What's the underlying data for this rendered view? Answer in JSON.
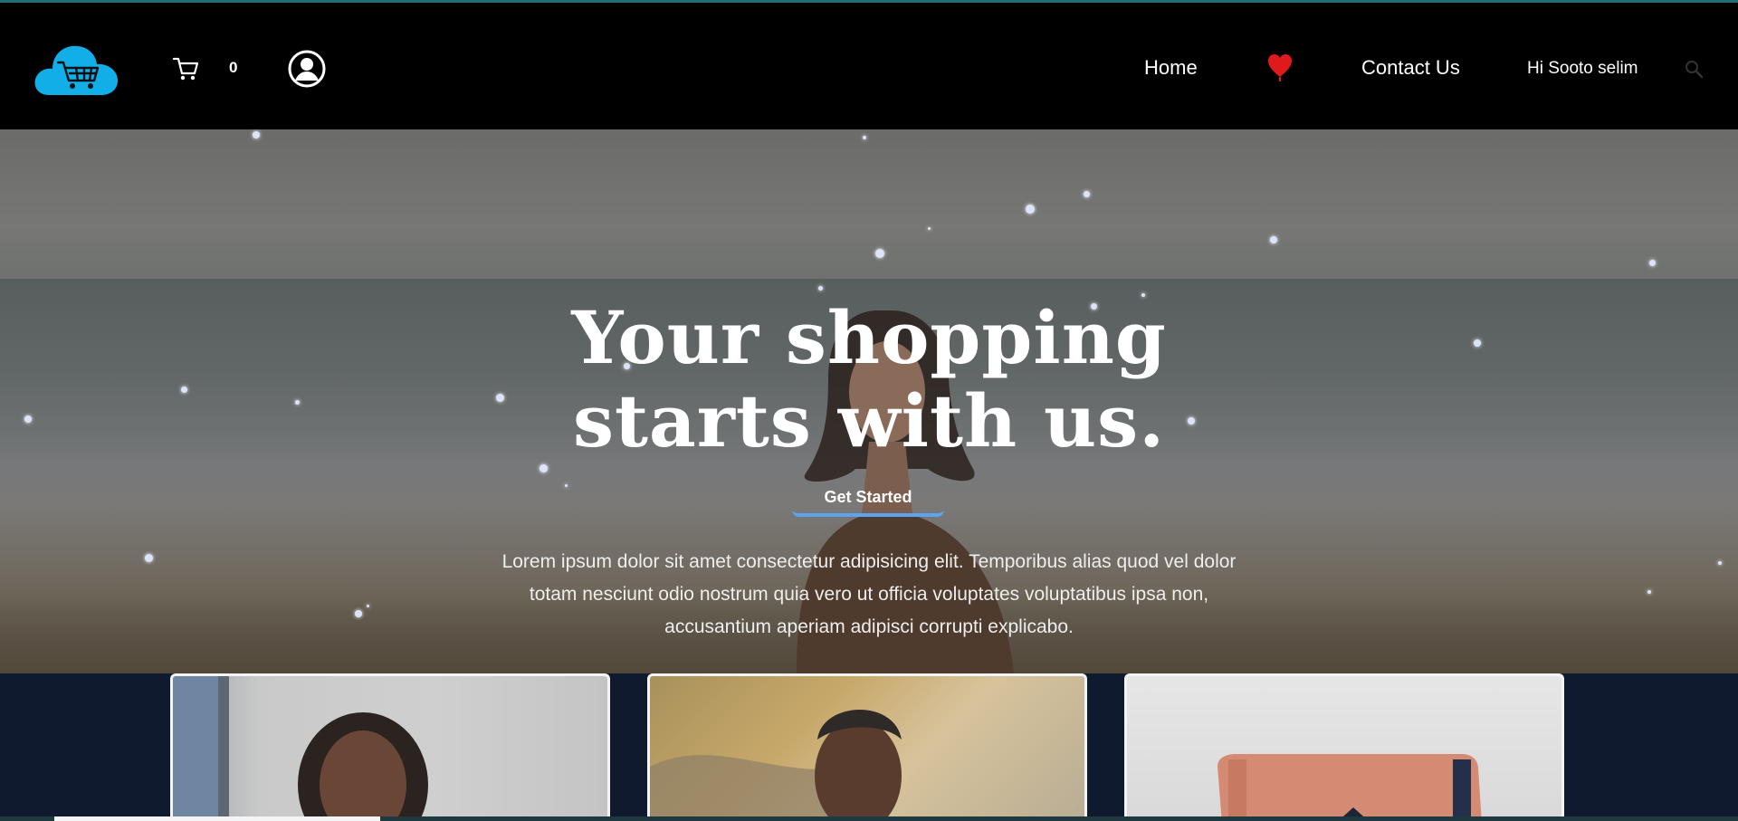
{
  "header": {
    "cart_count": "0",
    "nav": {
      "home": "Home",
      "contact": "Contact Us"
    },
    "greeting": "Hi Sooto selim"
  },
  "hero": {
    "title_line1": "Your shopping",
    "title_line2": "starts with us.",
    "cta_label": "Get Started",
    "description": "Lorem ipsum dolor sit amet consectetur adipisicing elit. Temporibus alias quod vel dolor totam nesciunt odio nostrum quia vero ut officia voluptates voluptatibus ipsa non, accusantium aperiam adipisci corrupti explicabo."
  },
  "icons": {
    "logo": "cloud-cart-logo",
    "cart": "cart-icon",
    "user": "user-circle-icon",
    "favorites": "heart-icon",
    "search": "search-icon"
  },
  "colors": {
    "header_bg": "#000000",
    "logo_cloud": "#12aee8",
    "heart": "#e0191b",
    "cta_underline": "#5ba4f4",
    "cards_bg": "#0f1a2e"
  }
}
